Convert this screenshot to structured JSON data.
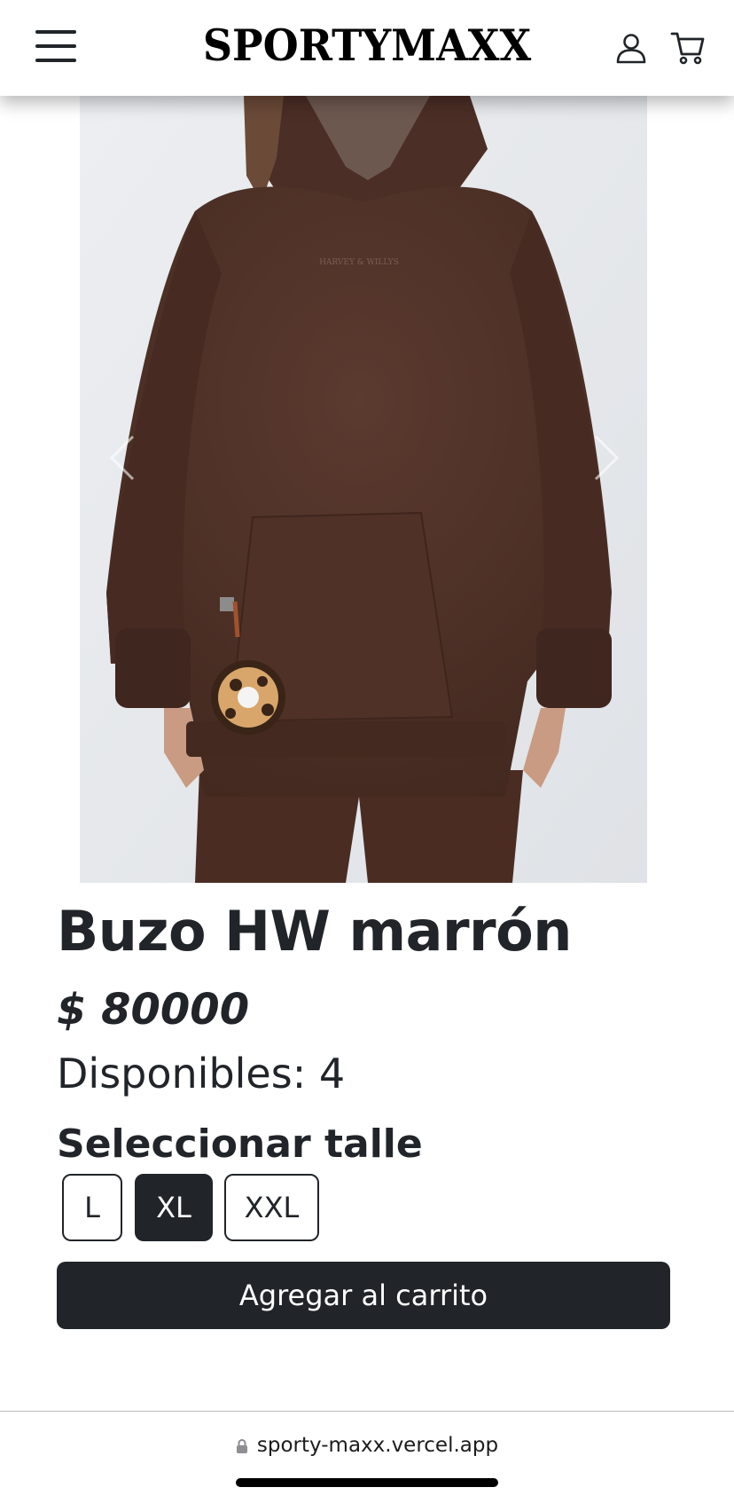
{
  "header": {
    "brand": "SPORTYMAXX",
    "icons": {
      "menu": "hamburger-menu-icon",
      "user": "user-icon",
      "cart": "cart-icon"
    }
  },
  "product": {
    "image_print_text": "HARVEY & WILLYS",
    "title": "Buzo HW marrón",
    "price": "$ 80000",
    "stock_label": "Disponibles:",
    "stock_value": "4",
    "size_heading": "Seleccionar talle",
    "sizes": [
      {
        "label": "L",
        "selected": false
      },
      {
        "label": "XL",
        "selected": true
      },
      {
        "label": "XXL",
        "selected": false
      }
    ],
    "add_to_cart_label": "Agregar al carrito"
  },
  "browser": {
    "url": "sporty-maxx.vercel.app"
  },
  "colors": {
    "dark": "#212529",
    "hoodie_brown": "#4e3128",
    "background_gray": "#e7e9ec"
  }
}
